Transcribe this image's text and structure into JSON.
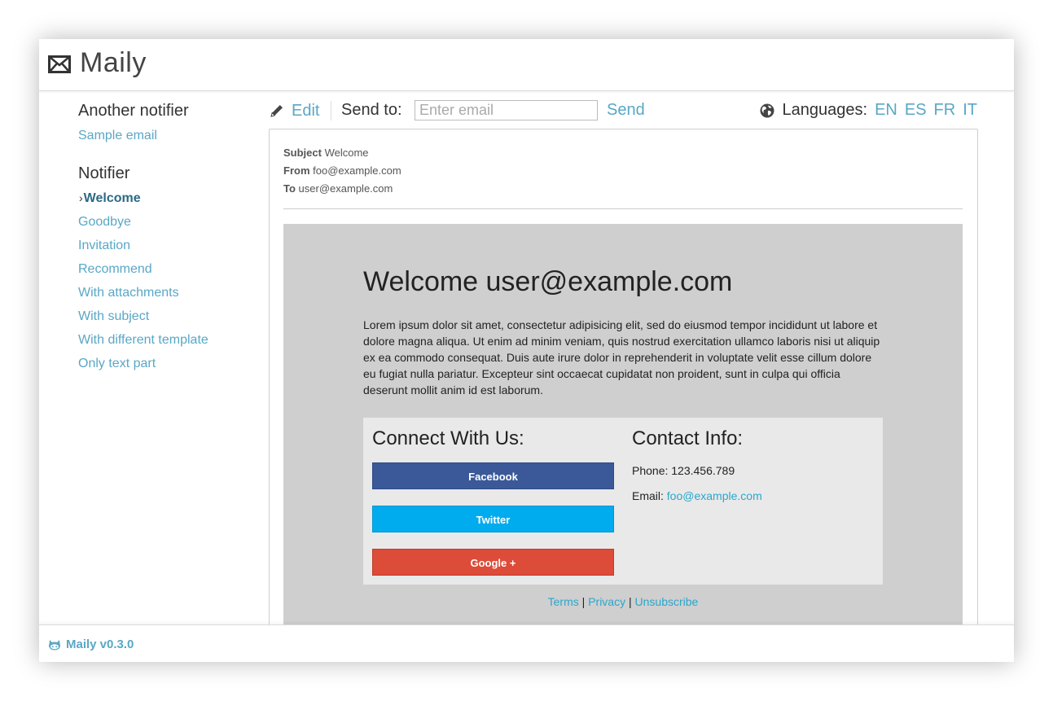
{
  "app": {
    "name": "Maily"
  },
  "sidebar": {
    "groups": [
      {
        "title": "Another notifier",
        "items": [
          {
            "label": "Sample email"
          }
        ]
      },
      {
        "title": "Notifier",
        "items": [
          {
            "label": "Welcome",
            "active": true
          },
          {
            "label": "Goodbye"
          },
          {
            "label": "Invitation"
          },
          {
            "label": "Recommend"
          },
          {
            "label": "With attachments"
          },
          {
            "label": "With subject"
          },
          {
            "label": "With different template"
          },
          {
            "label": "Only text part"
          }
        ]
      }
    ]
  },
  "toolbar": {
    "edit_label": "Edit",
    "send_to_label": "Send to:",
    "email_placeholder": "Enter email",
    "send_label": "Send",
    "languages_label": "Languages:",
    "languages": [
      "EN",
      "ES",
      "FR",
      "IT"
    ]
  },
  "email": {
    "subject_label": "Subject",
    "subject": "Welcome",
    "from_label": "From",
    "from": "foo@example.com",
    "to_label": "To",
    "to": "user@example.com",
    "heading": "Welcome user@example.com",
    "body": "Lorem ipsum dolor sit amet, consectetur adipisicing elit, sed do eiusmod tempor incididunt ut labore et dolore magna aliqua. Ut enim ad minim veniam, quis nostrud exercitation ullamco laboris nisi ut aliquip ex ea commodo consequat. Duis aute irure dolor in reprehenderit in voluptate velit esse cillum dolore eu fugiat nulla pariatur. Excepteur sint occaecat cupidatat non proident, sunt in culpa qui officia deserunt mollit anim id est laborum.",
    "connect_title": "Connect With Us:",
    "facebook_label": "Facebook",
    "twitter_label": "Twitter",
    "google_label": "Google +",
    "contact_title": "Contact Info:",
    "phone": "Phone: 123.456.789",
    "email_label": "Email:",
    "email_value": "foo@example.com",
    "footer_links": [
      "Terms",
      "Privacy",
      "Unsubscribe"
    ],
    "footer_separator": "|"
  },
  "footer": {
    "version_label": "Maily v0.3.0"
  },
  "colors": {
    "accent": "#5aa7c6",
    "active_link": "#2b6a84",
    "facebook": "#3b5998",
    "twitter": "#00aced",
    "google": "#dd4b39",
    "email_canvas": "#cfcfcf",
    "email_link": "#2ba6cb"
  },
  "icons": {
    "logo": "envelope-icon",
    "edit": "pencil-icon",
    "languages": "globe-icon",
    "footer": "octocat-icon"
  }
}
